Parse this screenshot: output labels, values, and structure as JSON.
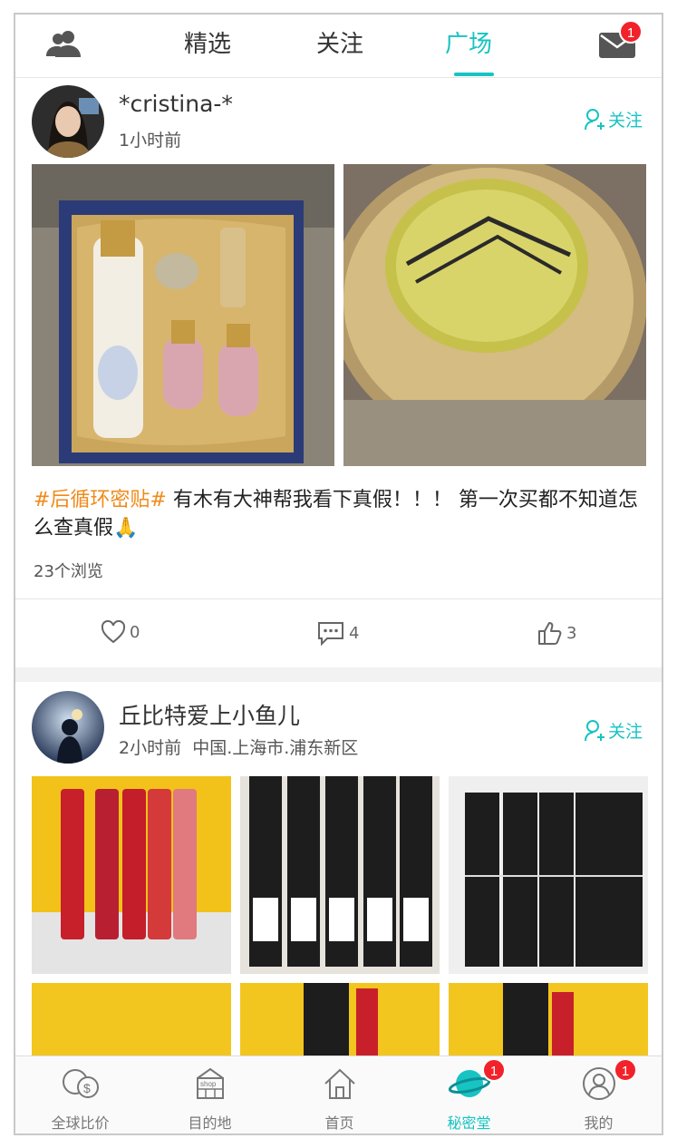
{
  "topnav": {
    "tabs": [
      {
        "label": "精选",
        "active": false
      },
      {
        "label": "关注",
        "active": false
      },
      {
        "label": "广场",
        "active": true
      }
    ],
    "mail_badge": "1",
    "accent_color": "#18c3c3"
  },
  "posts": [
    {
      "author": "*cristina-*",
      "time": "1小时前",
      "location": "",
      "follow_label": "关注",
      "hashtag": "#后循环密贴#",
      "text": " 有木有大神帮我看下真假！！！ 第一次买都不知道怎么查真假🙏",
      "views": "23个浏览",
      "likes": "0",
      "comments": "4",
      "thumbs": "3"
    },
    {
      "author": "丘比特爱上小鱼儿",
      "time": "2小时前",
      "location": "中国.上海市.浦东新区",
      "follow_label": "关注"
    }
  ],
  "bottomnav": {
    "items": [
      {
        "label": "全球比价",
        "icon": "price-compare-icon",
        "badge": ""
      },
      {
        "label": "目的地",
        "icon": "shop-icon",
        "badge": ""
      },
      {
        "label": "首页",
        "icon": "home-icon",
        "badge": ""
      },
      {
        "label": "秘密堂",
        "icon": "planet-icon",
        "badge": "1",
        "active": true
      },
      {
        "label": "我的",
        "icon": "profile-icon",
        "badge": "1"
      }
    ]
  }
}
